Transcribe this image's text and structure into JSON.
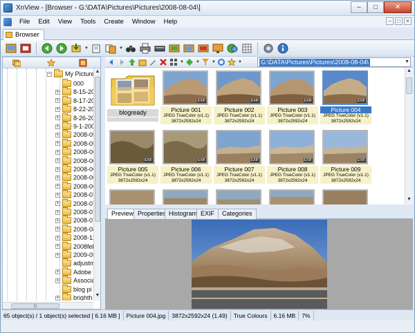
{
  "window": {
    "title": "XnView - [Browser - G:\\DATA\\Pictures\\Pictures\\2008-08-04\\]",
    "minimize": "–",
    "maximize": "□",
    "close": "✕"
  },
  "menu": {
    "items": [
      "File",
      "Edit",
      "View",
      "Tools",
      "Create",
      "Window",
      "Help"
    ],
    "mdi": [
      "–",
      "□",
      "×"
    ]
  },
  "tab": {
    "label": "Browser"
  },
  "toolbar": {
    "icons": [
      "browser-icon",
      "fullscreen-icon",
      "previous-icon",
      "next-icon",
      "import-icon",
      "slideshow-icon",
      "copy-icon",
      "binoculars-icon",
      "print-icon",
      "scanner-icon",
      "batch-convert-icon",
      "rename-icon",
      "image-edit-icon",
      "web-page-icon",
      "capture-icon",
      "contact-sheet-icon",
      "settings-icon",
      "info-icon"
    ]
  },
  "left_panel": {
    "root_label": "My Picture",
    "items": [
      "000",
      "8-15-20",
      "8-17-20",
      "8-22-20",
      "8-26-20",
      "9-1-200",
      "2008-05",
      "2008-05",
      "2008-06",
      "2008-06",
      "2008-06",
      "2008-06",
      "2008-06",
      "2008-07",
      "2008-07",
      "2008-07",
      "2008-07",
      "2008-08",
      "2008-12",
      "2008feb",
      "2009-05",
      "adjustm",
      "Adobe",
      "Associa",
      "blog pi",
      "brighth"
    ],
    "scroll_grip": "|||"
  },
  "nav": {
    "path": "G:\\DATA\\Pictures\\Pictures\\2008-08-04\\"
  },
  "thumbnails": [
    {
      "name": "blogready",
      "kind": "folder"
    },
    {
      "name": "Picture 001",
      "info1": "JPEG TrueColor (v1.1)",
      "info2": "3872x2592x24",
      "exif": "EXIF"
    },
    {
      "name": "Picture 002",
      "info1": "JPEG TrueColor (v1.1)",
      "info2": "3872x2592x24",
      "exif": "EXIF"
    },
    {
      "name": "Picture 003",
      "info1": "JPEG TrueColor (v1.1)",
      "info2": "3872x2592x24",
      "exif": "EXIF"
    },
    {
      "name": "Picture 004",
      "info1": "JPEG TrueColor (v1.1)",
      "info2": "3872x2592x24",
      "exif": "EXIF",
      "selected": true
    },
    {
      "name": "Picture 005",
      "info1": "JPEG TrueColor (v1.1)",
      "info2": "3872x2592x24",
      "exif": "EXIF"
    },
    {
      "name": "Picture 006",
      "info1": "JPEG TrueColor (v1.1)",
      "info2": "3872x2592x24",
      "exif": "EXIF"
    },
    {
      "name": "Picture 007",
      "info1": "JPEG TrueColor (v1.1)",
      "info2": "3872x2592x24",
      "exif": "EXIF"
    },
    {
      "name": "Picture 008",
      "info1": "JPEG TrueColor (v1.1)",
      "info2": "3872x2592x24",
      "exif": "EXIF"
    },
    {
      "name": "Picture 009",
      "info1": "JPEG TrueColor (v1.1)",
      "info2": "3872x2592x24",
      "exif": "EXIF"
    }
  ],
  "preview_tabs": [
    "Preview",
    "Properties",
    "Histogram",
    "EXIF",
    "Categories"
  ],
  "status": {
    "selection": "65 object(s) / 1 object(s) selected  [ 6.16 MB ]",
    "filename": "Picture 004.jpg",
    "dimensions": "3872x2592x24 (1.49)",
    "colours": "True Colours",
    "size": "6.16 MB",
    "zoom": "7%"
  },
  "colors": {
    "selection": "#3a78c8",
    "label_bg": "#f6f1c8",
    "preview_bg": "#a8a8a8"
  }
}
